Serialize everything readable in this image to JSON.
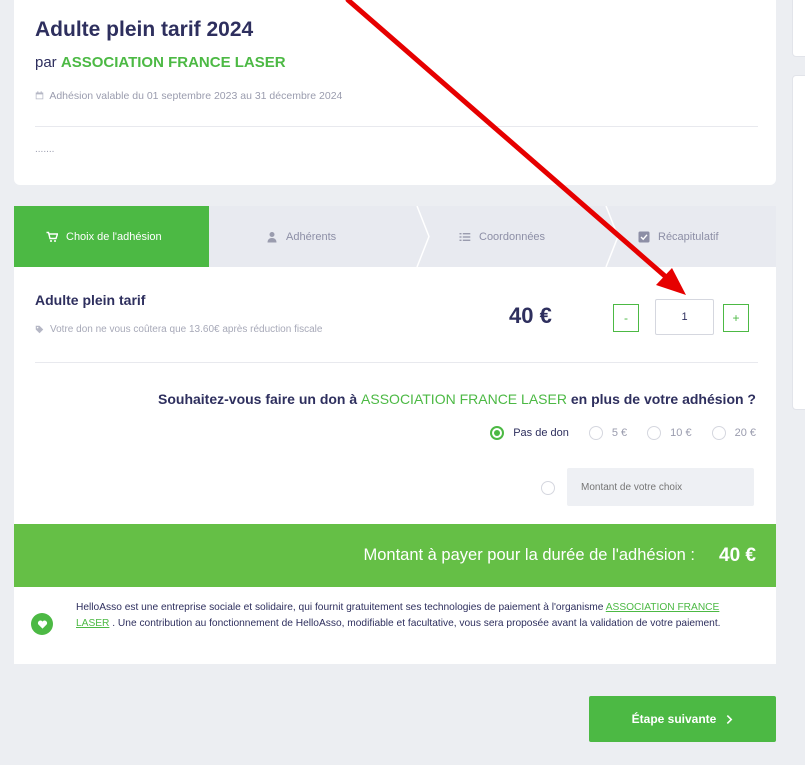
{
  "header": {
    "title": "Adulte plein tarif 2024",
    "by_prefix": "par",
    "organization": "ASSOCIATION FRANCE LASER",
    "validity": "Adhésion valable du 01 septembre 2023 au 31 décembre 2024",
    "description": "......."
  },
  "steps": [
    {
      "label": "Choix de l'adhésion",
      "icon": "cart-icon",
      "active": true
    },
    {
      "label": "Adhérents",
      "icon": "user-icon",
      "active": false
    },
    {
      "label": "Coordonnées",
      "icon": "list-icon",
      "active": false
    },
    {
      "label": "Récapitulatif",
      "icon": "check-square-icon",
      "active": false
    }
  ],
  "product": {
    "name": "Adulte plein tarif",
    "tax_note": "Votre don ne vous coûtera que 13.60€ après réduction fiscale",
    "price": "40 €",
    "quantity": "1",
    "minus_label": "-",
    "plus_label": "+"
  },
  "donation": {
    "question_before": "Souhaitez-vous faire un don à",
    "organization": "ASSOCIATION FRANCE LASER",
    "question_after": "en plus de votre adhésion ?",
    "options": [
      "Pas de don",
      "5 €",
      "10 €",
      "20 €"
    ],
    "selected": "Pas de don",
    "custom_placeholder": "Montant de votre choix"
  },
  "total": {
    "label": "Montant à payer pour la durée de l'adhésion :",
    "value": "40 €"
  },
  "info": {
    "text_before": "HelloAsso est une entreprise sociale et solidaire, qui fournit gratuitement ses technologies de paiement à l'organisme",
    "org_link": "ASSOCIATION FRANCE LASER",
    "text_after": ". Une contribution au fonctionnement de HelloAsso, modifiable et facultative, vous sera proposée avant la validation de votre paiement."
  },
  "next_button": {
    "label": "Étape suivante",
    "icon": "chevron-right-icon"
  },
  "colors": {
    "green": "#4cb944",
    "navy": "#2e2f5e",
    "arrow": "#e60000"
  }
}
